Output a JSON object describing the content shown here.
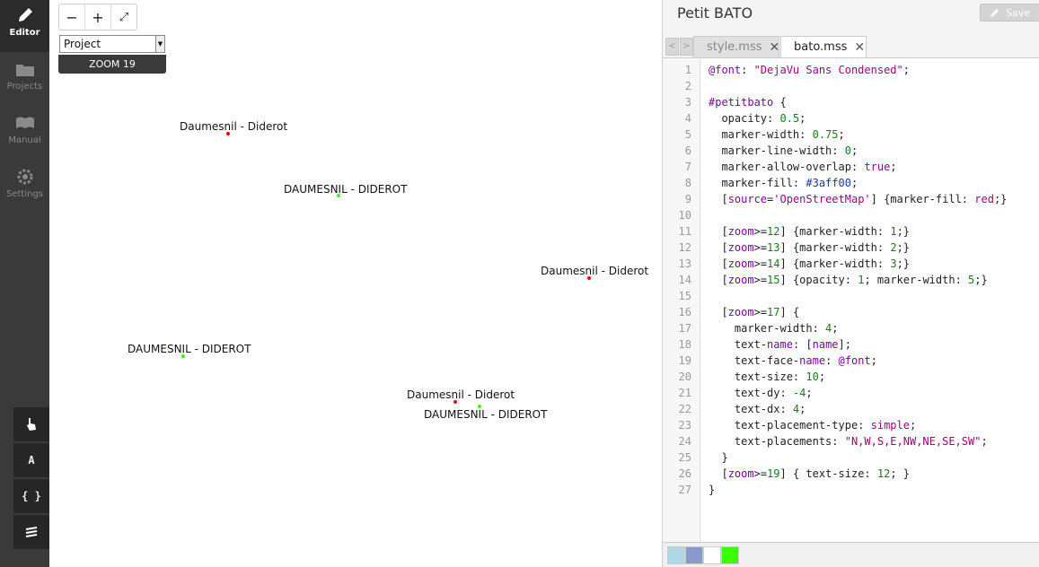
{
  "sidebar": {
    "items": [
      {
        "label": "Editor",
        "icon": "pencil-icon"
      },
      {
        "label": "Projects",
        "icon": "folder-icon"
      },
      {
        "label": "Manual",
        "icon": "book-icon"
      },
      {
        "label": "Settings",
        "icon": "gear-icon"
      }
    ],
    "tools": [
      {
        "icon": "hand-pointer-icon",
        "glyph": ""
      },
      {
        "icon": "font-icon",
        "glyph": "A"
      },
      {
        "icon": "braces-icon",
        "glyph": "{ }"
      },
      {
        "icon": "layers-icon",
        "glyph": ""
      }
    ]
  },
  "map": {
    "zoom_out": "−",
    "zoom_in": "+",
    "fullscreen": "⤢",
    "layer_select": "Project",
    "zoom_badge": "ZOOM 19",
    "labels": [
      "Daumesnil - Diderot",
      "DAUMESNIL - DIDEROT",
      "Daumesnil - Diderot",
      "DAUMESNIL - DIDEROT",
      "Daumesnil - Diderot",
      "DAUMESNIL - DIDEROT"
    ],
    "colors": {
      "red_marker": "#ff0000",
      "green_marker": "#3aff00"
    }
  },
  "editor": {
    "title": "Petit BATO",
    "save": "Save",
    "prev": "<",
    "next": ">",
    "tabs": [
      {
        "name": "style.mss",
        "close": "✕"
      },
      {
        "name": "bato.mss",
        "close": "✕"
      }
    ],
    "line_numbers": [
      "1",
      "2",
      "3",
      "4",
      "5",
      "6",
      "7",
      "8",
      "9",
      "10",
      "11",
      "12",
      "13",
      "14",
      "15",
      "16",
      "17",
      "18",
      "19",
      "20",
      "21",
      "22",
      "23",
      "24",
      "25",
      "26",
      "27"
    ],
    "code": [
      "@font: \"DejaVu Sans Condensed\";",
      "",
      "#petitbato {",
      "  opacity: 0.5;",
      "  marker-width: 0.75;",
      "  marker-line-width: 0;",
      "  marker-allow-overlap: true;",
      "  marker-fill: #3aff00;",
      "  [source='OpenStreetMap'] {marker-fill: red;}",
      "",
      "  [zoom>=12] {marker-width: 1;}",
      "  [zoom>=13] {marker-width: 2;}",
      "  [zoom>=14] {marker-width: 3;}",
      "  [zoom>=15] {opacity: 1; marker-width: 5;}",
      "",
      "  [zoom>=17] {",
      "    marker-width: 4;",
      "    text-name: [name];",
      "    text-face-name: @font;",
      "    text-size: 10;",
      "    text-dy: -4;",
      "    text-dx: 4;",
      "    text-placement-type: simple;",
      "    text-placements: \"N,W,S,E,NW,NE,SE,SW\";",
      "  }",
      "  [zoom>=19] { text-size: 12; }",
      "}"
    ],
    "palette": [
      "#add8e6",
      "#8899cc",
      "#ffffff",
      "#3aff00"
    ]
  }
}
